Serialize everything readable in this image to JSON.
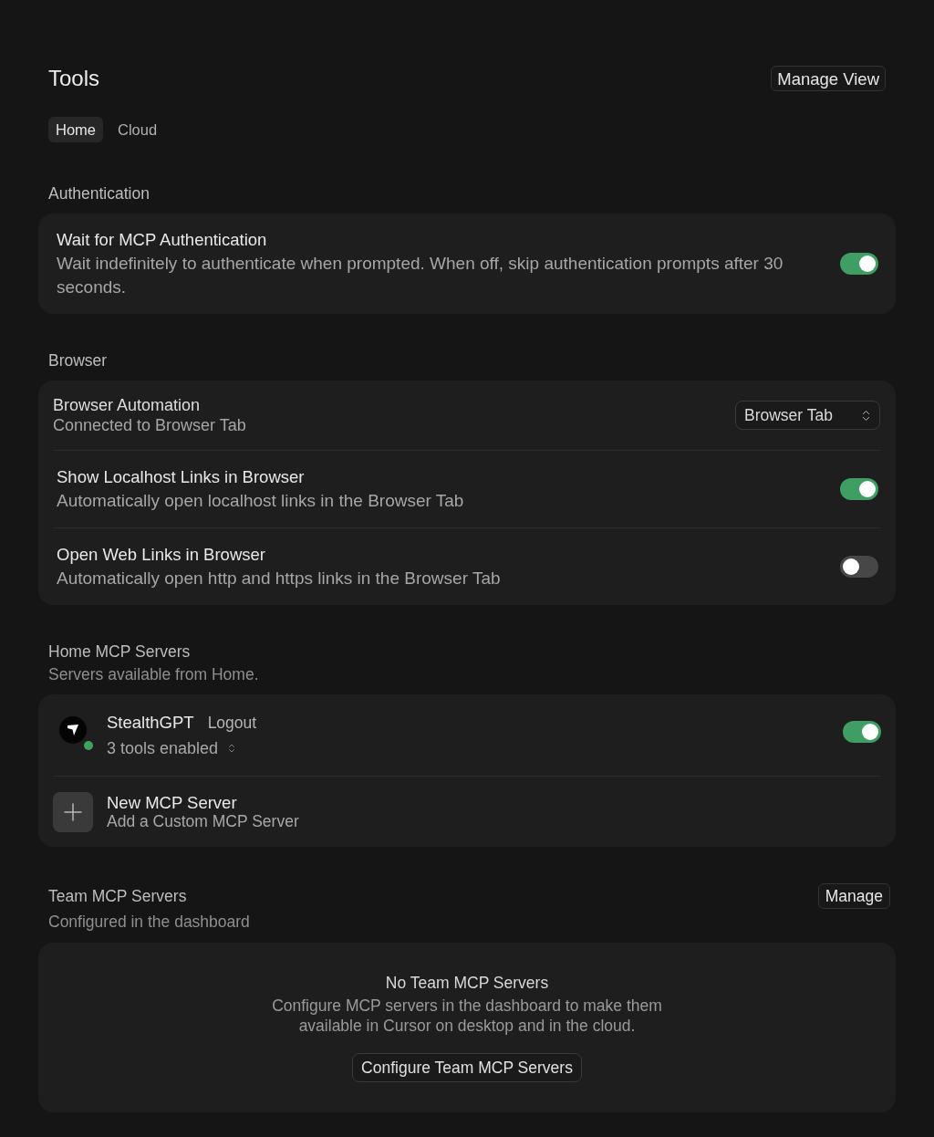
{
  "header": {
    "title": "Tools",
    "button": "Manage View"
  },
  "tabs": [
    {
      "label": "Home",
      "selected": true
    },
    {
      "label": "Cloud",
      "selected": false
    }
  ],
  "authentication": {
    "heading": "Authentication",
    "settings": [
      {
        "kind": "toggle",
        "title": "Wait for MCP Authentication",
        "description": "Wait indefinitely to authenticate when prompted. When off, skip authentication prompts after 30 seconds.",
        "on": true
      }
    ]
  },
  "browser": {
    "heading": "Browser",
    "settings": [
      {
        "kind": "select",
        "title": "Browser Automation",
        "description": "Connected to Browser Tab",
        "value": "Browser Tab"
      },
      {
        "kind": "toggle",
        "title": "Show Localhost Links in Browser",
        "description": "Automatically open localhost links in the Browser Tab",
        "on": true
      },
      {
        "kind": "toggle",
        "title": "Open Web Links in Browser",
        "description": "Automatically open http and https links in the Browser Tab",
        "on": false
      }
    ]
  },
  "home_mcp_servers": {
    "heading": "Home MCP Servers",
    "subheading": "Servers available from Home.",
    "servers": [
      {
        "name": "StealthGPT",
        "action": "Logout",
        "tools": "3 tools enabled",
        "connected": true,
        "on": true
      }
    ],
    "new_server": {
      "title": "New MCP Server",
      "description": "Add a Custom MCP Server"
    }
  },
  "team_mcp_servers": {
    "heading": "Team MCP Servers",
    "subheading": "Configured in the dashboard",
    "button": "Manage",
    "empty_state": {
      "title": "No Team MCP Servers",
      "description": "Configure MCP servers in the dashboard to make them available in Cursor on desktop and in the cloud.",
      "button": "Configure Team MCP Servers"
    }
  }
}
